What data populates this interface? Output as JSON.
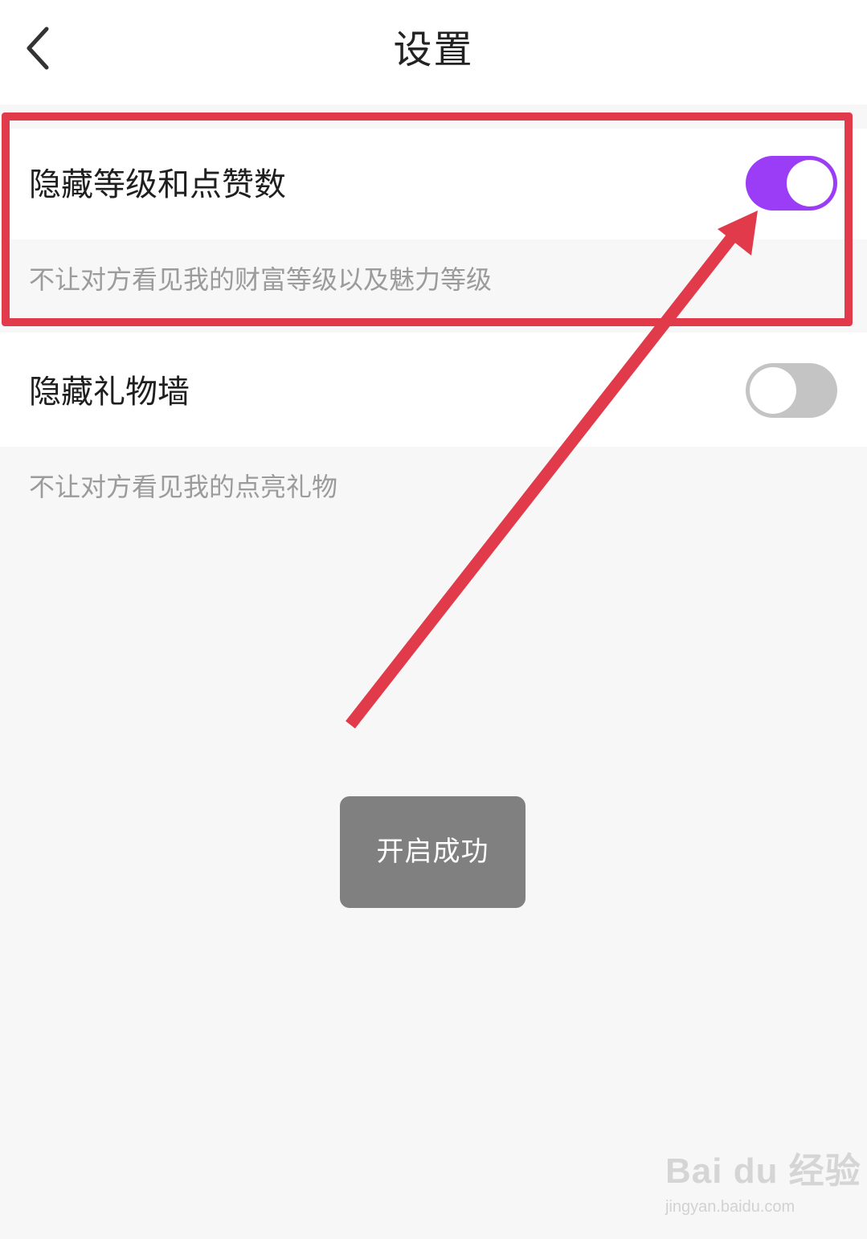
{
  "header": {
    "back_icon": "chevron-left-icon",
    "title": "设置"
  },
  "settings": [
    {
      "label": "隐藏等级和点赞数",
      "description": "不让对方看见我的财富等级以及魅力等级",
      "enabled": true
    },
    {
      "label": "隐藏礼物墙",
      "description": "不让对方看见我的点亮礼物",
      "enabled": false
    }
  ],
  "toast": {
    "text": "开启成功"
  },
  "annotation": {
    "highlight_color": "#e13a4a",
    "arrow_icon": "arrow-up-right-icon"
  },
  "colors": {
    "toggle_on": "#9b3cf6",
    "toggle_off": "#c4c4c4",
    "background": "#f7f7f7"
  },
  "watermark": {
    "logo": "Bai du 经验",
    "url": "jingyan.baidu.com"
  }
}
